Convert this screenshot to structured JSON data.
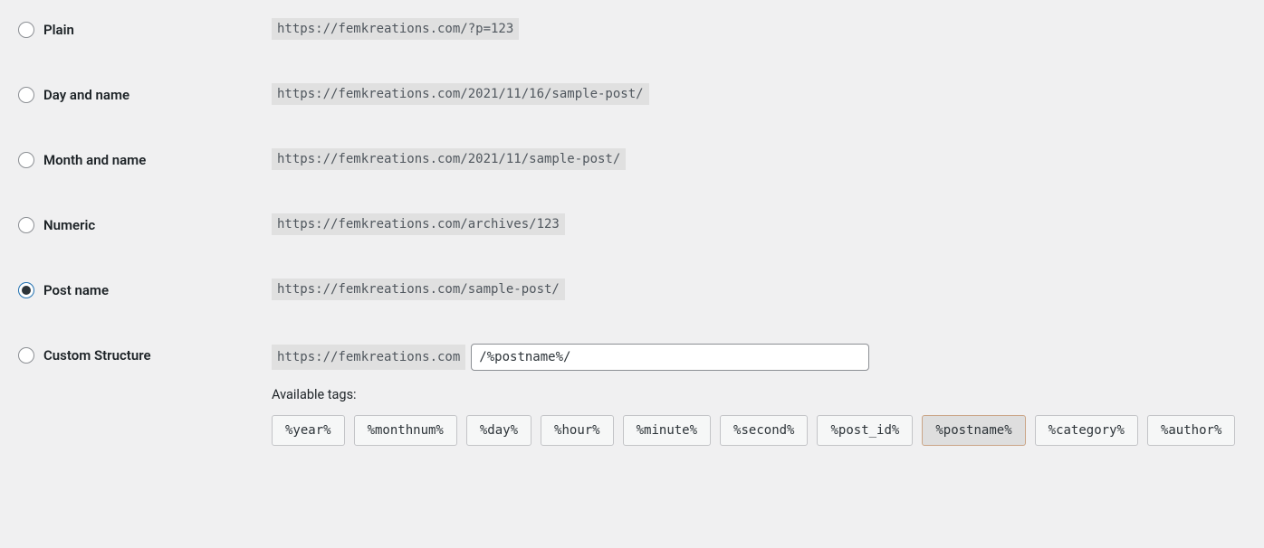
{
  "options": [
    {
      "id": "plain",
      "label": "Plain",
      "example": "https://femkreations.com/?p=123",
      "checked": false
    },
    {
      "id": "day-name",
      "label": "Day and name",
      "example": "https://femkreations.com/2021/11/16/sample-post/",
      "checked": false
    },
    {
      "id": "month-name",
      "label": "Month and name",
      "example": "https://femkreations.com/2021/11/sample-post/",
      "checked": false
    },
    {
      "id": "numeric",
      "label": "Numeric",
      "example": "https://femkreations.com/archives/123",
      "checked": false
    },
    {
      "id": "post-name",
      "label": "Post name",
      "example": "https://femkreations.com/sample-post/",
      "checked": true
    }
  ],
  "custom": {
    "label": "Custom Structure",
    "base_url": "https://femkreations.com",
    "value": "/%postname%/",
    "checked": false
  },
  "available_tags_label": "Available tags:",
  "tags": [
    {
      "text": "%year%",
      "active": false
    },
    {
      "text": "%monthnum%",
      "active": false
    },
    {
      "text": "%day%",
      "active": false
    },
    {
      "text": "%hour%",
      "active": false
    },
    {
      "text": "%minute%",
      "active": false
    },
    {
      "text": "%second%",
      "active": false
    },
    {
      "text": "%post_id%",
      "active": false
    },
    {
      "text": "%postname%",
      "active": true
    },
    {
      "text": "%category%",
      "active": false
    },
    {
      "text": "%author%",
      "active": false
    }
  ]
}
